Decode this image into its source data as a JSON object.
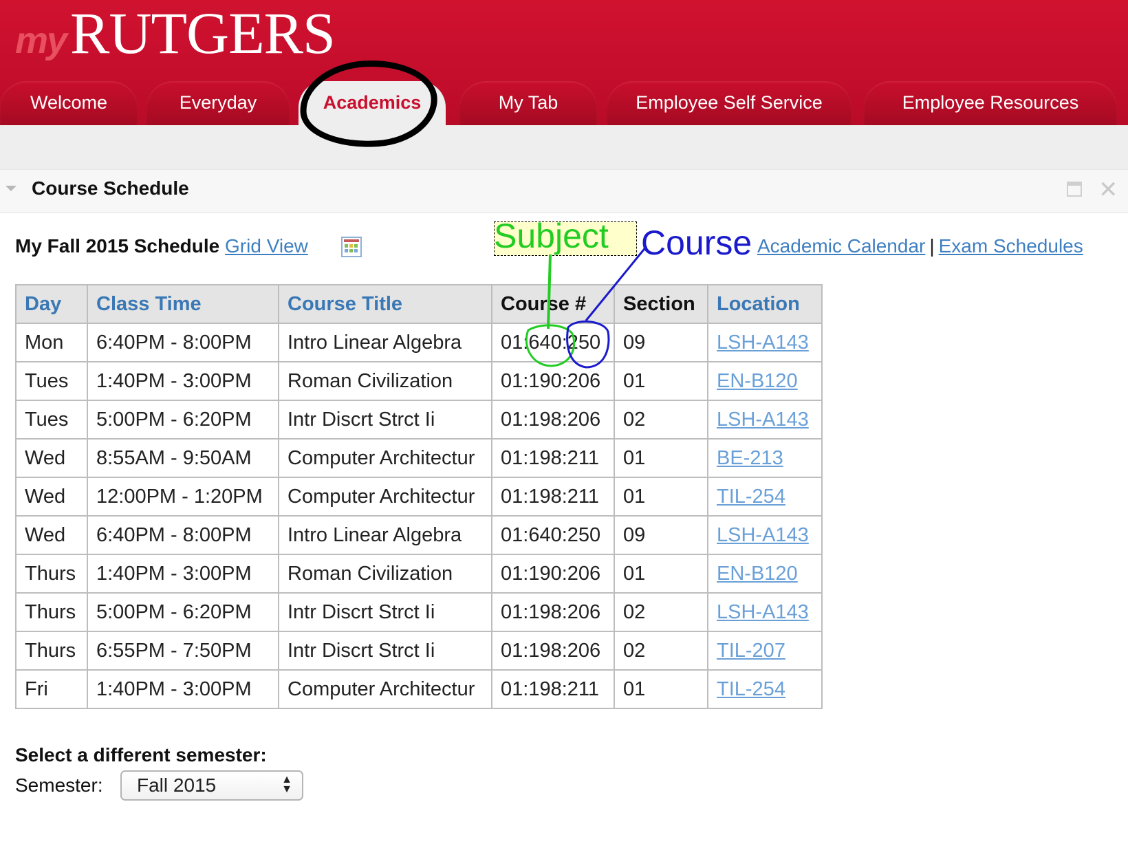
{
  "brand": {
    "logo_my": "my",
    "logo_rutgers": "RUTGERS"
  },
  "tabs": [
    {
      "label": "Welcome",
      "active": false
    },
    {
      "label": "Everyday",
      "active": false
    },
    {
      "label": "Academics",
      "active": true
    },
    {
      "label": "My Tab",
      "active": false
    },
    {
      "label": "Employee Self Service",
      "active": false
    },
    {
      "label": "Employee Resources",
      "active": false
    }
  ],
  "portlet": {
    "title": "Course Schedule"
  },
  "schedule": {
    "heading": "My Fall 2015 Schedule",
    "grid_view_link": "Grid View",
    "academic_calendar_link": "Academic Calendar",
    "separator": "|",
    "exam_schedules_link": "Exam Schedules"
  },
  "annotations": {
    "subject": "Subject",
    "course": "Course"
  },
  "table": {
    "headers": [
      "Day",
      "Class Time",
      "Course Title",
      "Course #",
      "Section",
      "Location"
    ],
    "rows": [
      [
        "Mon",
        "6:40PM - 8:00PM",
        "Intro Linear Algebra",
        "01:640:250",
        "09",
        "LSH-A143"
      ],
      [
        "Tues",
        "1:40PM - 3:00PM",
        "Roman Civilization",
        "01:190:206",
        "01",
        "EN-B120"
      ],
      [
        "Tues",
        "5:00PM - 6:20PM",
        "Intr Discrt Strct Ii",
        "01:198:206",
        "02",
        "LSH-A143"
      ],
      [
        "Wed",
        "8:55AM - 9:50AM",
        "Computer Architectur",
        "01:198:211",
        "01",
        "BE-213"
      ],
      [
        "Wed",
        "12:00PM - 1:20PM",
        "Computer Architectur",
        "01:198:211",
        "01",
        "TIL-254"
      ],
      [
        "Wed",
        "6:40PM - 8:00PM",
        "Intro Linear Algebra",
        "01:640:250",
        "09",
        "LSH-A143"
      ],
      [
        "Thurs",
        "1:40PM - 3:00PM",
        "Roman Civilization",
        "01:190:206",
        "01",
        "EN-B120"
      ],
      [
        "Thurs",
        "5:00PM - 6:20PM",
        "Intr Discrt Strct Ii",
        "01:198:206",
        "02",
        "LSH-A143"
      ],
      [
        "Thurs",
        "6:55PM - 7:50PM",
        "Intr Discrt Strct Ii",
        "01:198:206",
        "02",
        "TIL-207"
      ],
      [
        "Fri",
        "1:40PM - 3:00PM",
        "Computer Architectur",
        "01:198:211",
        "01",
        "TIL-254"
      ]
    ]
  },
  "semester": {
    "heading": "Select a different semester:",
    "label": "Semester:",
    "selected": "Fall 2015"
  },
  "colors": {
    "brand_red": "#c8102e",
    "link_blue": "#3e7fc1",
    "subject_annotation": "#22cc22",
    "course_annotation": "#1a1acc"
  },
  "icons": [
    "grid-view-icon",
    "maximize-icon",
    "close-icon",
    "select-arrows-icon",
    "collapse-arrow-icon"
  ]
}
